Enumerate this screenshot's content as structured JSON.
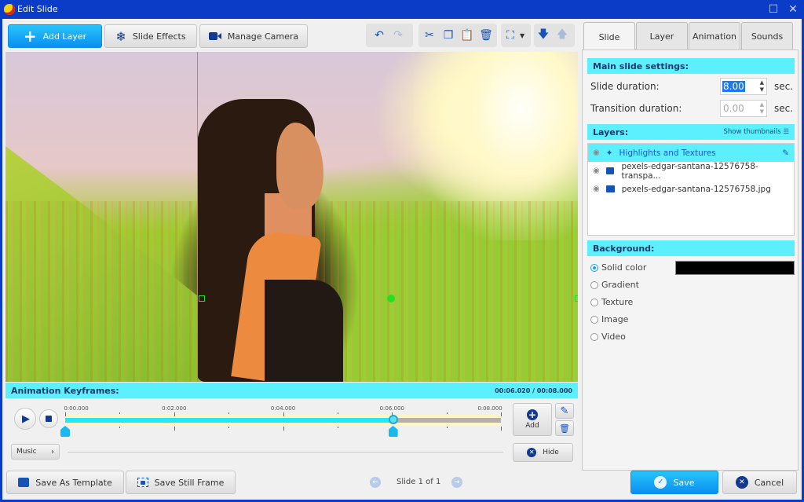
{
  "window": {
    "title": "Edit Slide"
  },
  "toolbar": {
    "add_layer": "Add Layer",
    "slide_effects": "Slide Effects",
    "manage_camera": "Manage Camera",
    "tools": [
      "undo-icon",
      "redo-icon",
      "cut-icon",
      "copy-icon",
      "paste-icon",
      "delete-icon",
      "fit-icon",
      "move-down-icon",
      "move-up-icon"
    ]
  },
  "tabs": [
    {
      "label": "Slide",
      "active": true
    },
    {
      "label": "Layer",
      "active": false
    },
    {
      "label": "Animation",
      "active": false
    },
    {
      "label": "Sounds",
      "active": false
    }
  ],
  "main_settings": {
    "header": "Main slide settings:",
    "slide_duration_label": "Slide duration:",
    "slide_duration_value": "8.00",
    "transition_duration_label": "Transition duration:",
    "transition_duration_value": "0.00",
    "unit": "sec."
  },
  "layers": {
    "header": "Layers:",
    "show_thumbnails": "Show thumbnails",
    "items": [
      {
        "name": "Highlights and Textures",
        "type": "effect",
        "selected": true
      },
      {
        "name": "pexels-edgar-santana-12576758-transpa...",
        "type": "image",
        "selected": false
      },
      {
        "name": "pexels-edgar-santana-12576758.jpg",
        "type": "image",
        "selected": false
      }
    ]
  },
  "background": {
    "header": "Background:",
    "options": [
      "Solid color",
      "Gradient",
      "Texture",
      "Image",
      "Video"
    ],
    "selected": "Solid color",
    "color": "#000000"
  },
  "keyframes": {
    "header": "Animation Keyframes:",
    "time_display": "00:06.020 / 00:08.000",
    "ticks": [
      "0:00.000",
      "0:02.000",
      "0:04.000",
      "0:06.000",
      "0:08.000"
    ],
    "duration_sec": 8,
    "current_sec": 6.02,
    "keyframes_sec": [
      0,
      6.02
    ],
    "add_label": "Add",
    "hide_label": "Hide",
    "music_label": "Music"
  },
  "footer": {
    "save_template": "Save As Template",
    "save_still": "Save Still Frame",
    "slide_nav": "Slide 1 of 1",
    "save": "Save",
    "cancel": "Cancel"
  },
  "colors": {
    "accent": "#5cf0ff",
    "primary_button": "#0a8ff0",
    "title_bar": "#0a3cc8"
  }
}
